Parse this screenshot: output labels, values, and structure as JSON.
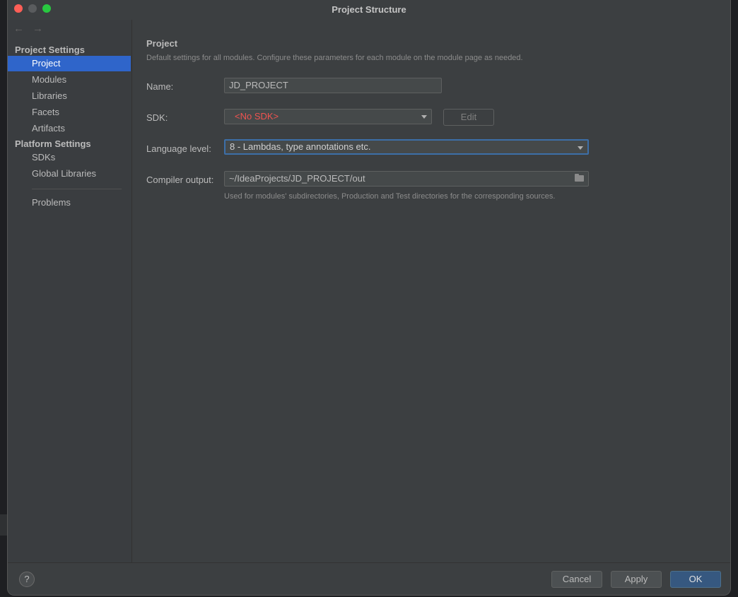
{
  "window": {
    "title": "Project Structure"
  },
  "sidebar": {
    "groups": [
      {
        "label": "Project Settings",
        "items": [
          "Project",
          "Modules",
          "Libraries",
          "Facets",
          "Artifacts"
        ]
      },
      {
        "label": "Platform Settings",
        "items": [
          "SDKs",
          "Global Libraries"
        ]
      }
    ],
    "problems": "Problems",
    "selected": "Project"
  },
  "main": {
    "title": "Project",
    "description": "Default settings for all modules. Configure these parameters for each module on the module page as needed.",
    "name_label": "Name:",
    "name_value": "JD_PROJECT",
    "sdk_label": "SDK:",
    "sdk_value": "<No SDK>",
    "edit_label": "Edit",
    "language_label": "Language level:",
    "language_value": "8 - Lambdas, type annotations etc.",
    "compiler_label": "Compiler output:",
    "compiler_value": "~/IdeaProjects/JD_PROJECT/out",
    "compiler_hint": "Used for modules' subdirectories, Production and Test directories for the corresponding sources."
  },
  "footer": {
    "help": "?",
    "cancel": "Cancel",
    "apply": "Apply",
    "ok": "OK"
  },
  "colors": {
    "selection": "#2f65ca",
    "error": "#ef5350",
    "primary_button": "#365880"
  }
}
